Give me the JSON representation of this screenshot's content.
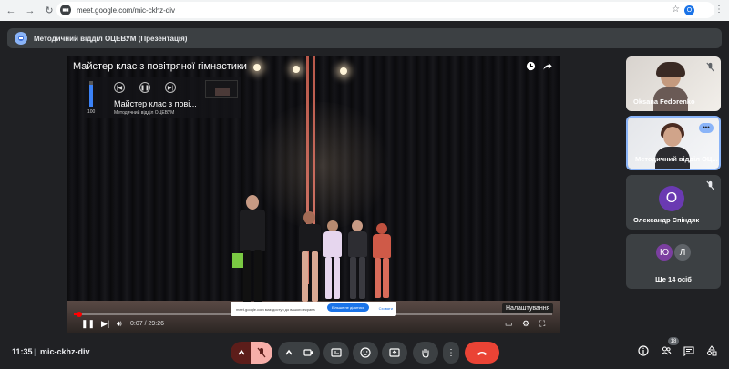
{
  "browser": {
    "url": "meet.google.com/mic-ckhz-div",
    "profile_initial": "O"
  },
  "banner": {
    "title": "Методичний відділ ОЦЕВУМ (Презентація)"
  },
  "video": {
    "title": "Майстер клас з повітряної гімнастики",
    "mini_player": {
      "volume": "100",
      "volume_level": 0.85,
      "title": "Майстер клас з пові...",
      "channel": "Методичний відділ ОЦЕВУМ"
    },
    "settings_tooltip": "Налаштування",
    "toast": {
      "text": "meet.google.com має доступ до вашого екрана",
      "action_label": "Більше не ділитися",
      "close_label": "Сховати"
    },
    "progress": {
      "current": "0:07",
      "duration": "29:26",
      "fraction": 0.004
    }
  },
  "participants": [
    {
      "name": "Oksana Fedorenko",
      "muted": true
    },
    {
      "name": "Методичний відділ ОЦ...",
      "muted": false,
      "active": true
    },
    {
      "name": "Олександр Спіндяк",
      "initial": "О",
      "muted": true
    },
    {
      "name": "Ще 14 осіб",
      "initials": [
        "Ю",
        "Л"
      ]
    }
  ],
  "bottom": {
    "time": "11:35",
    "separator": "|",
    "meeting_code": "mic-ckhz-div",
    "participants_count": "18"
  },
  "colors": {
    "accent": "#8ab4f8",
    "hangup": "#ea4335",
    "mic_off_bg": "#5c1d1a",
    "avatar_o": "#6a3ab2",
    "avatar_yu": "#7b3fa0",
    "avatar_l": "#5f6368"
  }
}
